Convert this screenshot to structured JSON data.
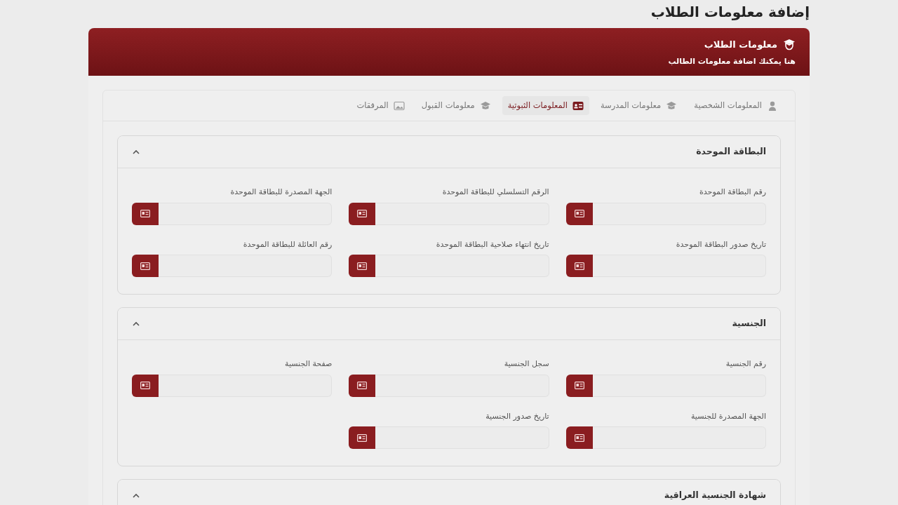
{
  "page_title": "إضافة معلومات الطلاب",
  "header": {
    "title": "معلومات الطلاب",
    "subtitle": "هنا يمكنك اضافة معلومات الطالب"
  },
  "tabs": [
    {
      "label": "المعلومات الشخصية",
      "selected": false
    },
    {
      "label": "معلومات المدرسة",
      "selected": false
    },
    {
      "label": "المعلومات الثبوتية",
      "selected": true
    },
    {
      "label": "معلومات القبول",
      "selected": false
    },
    {
      "label": "المرفقات",
      "selected": false
    }
  ],
  "sections": [
    {
      "title": "البطاقة الموحدة",
      "expanded": true,
      "fields": [
        {
          "label": "رقم البطاقة الموحدة"
        },
        {
          "label": "الرقم التسلسلي للبطاقة الموحدة"
        },
        {
          "label": "الجهة المصدرة للبطاقة الموحدة"
        },
        {
          "label": "تاريخ صدور البطاقة الموحدة"
        },
        {
          "label": "تاريخ انتهاء صلاحية البطاقة الموحدة"
        },
        {
          "label": "رقم العائلة للبطاقة الموحدة"
        }
      ]
    },
    {
      "title": "الجنسية",
      "expanded": true,
      "fields": [
        {
          "label": "رقم الجنسية"
        },
        {
          "label": "سجل الجنسية"
        },
        {
          "label": "صفحة الجنسية"
        },
        {
          "label": "الجهة المصدرة للجنسية"
        },
        {
          "label": "تاريخ صدور الجنسية"
        }
      ]
    },
    {
      "title": "شهادة الجنسية العراقية",
      "expanded": true
    }
  ]
}
